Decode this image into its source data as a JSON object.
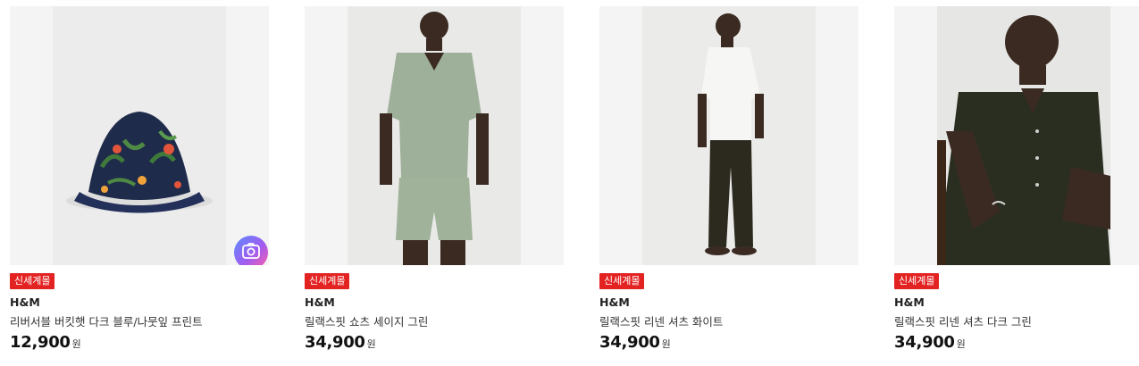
{
  "products": [
    {
      "image": "bucket-hat-photo",
      "badge": "신세계몰",
      "brand": "H&M",
      "name": "리버서블 버킷햇 다크 블루/나뭇잎 프린트",
      "price": "12,900",
      "currency": "원"
    },
    {
      "image": "relaxed-fit-shorts-photo",
      "badge": "신세계몰",
      "brand": "H&M",
      "name": "릴랙스핏 쇼츠 세이지 그린",
      "price": "34,900",
      "currency": "원"
    },
    {
      "image": "relaxed-fit-linen-shirt-white-photo",
      "badge": "신세계몰",
      "brand": "H&M",
      "name": "릴랙스핏 리넨 셔츠 화이트",
      "price": "34,900",
      "currency": "원"
    },
    {
      "image": "relaxed-fit-linen-shirt-dark-green-photo",
      "badge": "신세계몰",
      "brand": "H&M",
      "name": "릴랙스핏 리넨 셔츠 다크 그린",
      "price": "34,900",
      "currency": "원"
    }
  ],
  "colors": {
    "badge_bg": "#e32222",
    "thumb_bg": "#f4f4f4"
  },
  "icons": {
    "image_search": "camera-search-icon"
  }
}
